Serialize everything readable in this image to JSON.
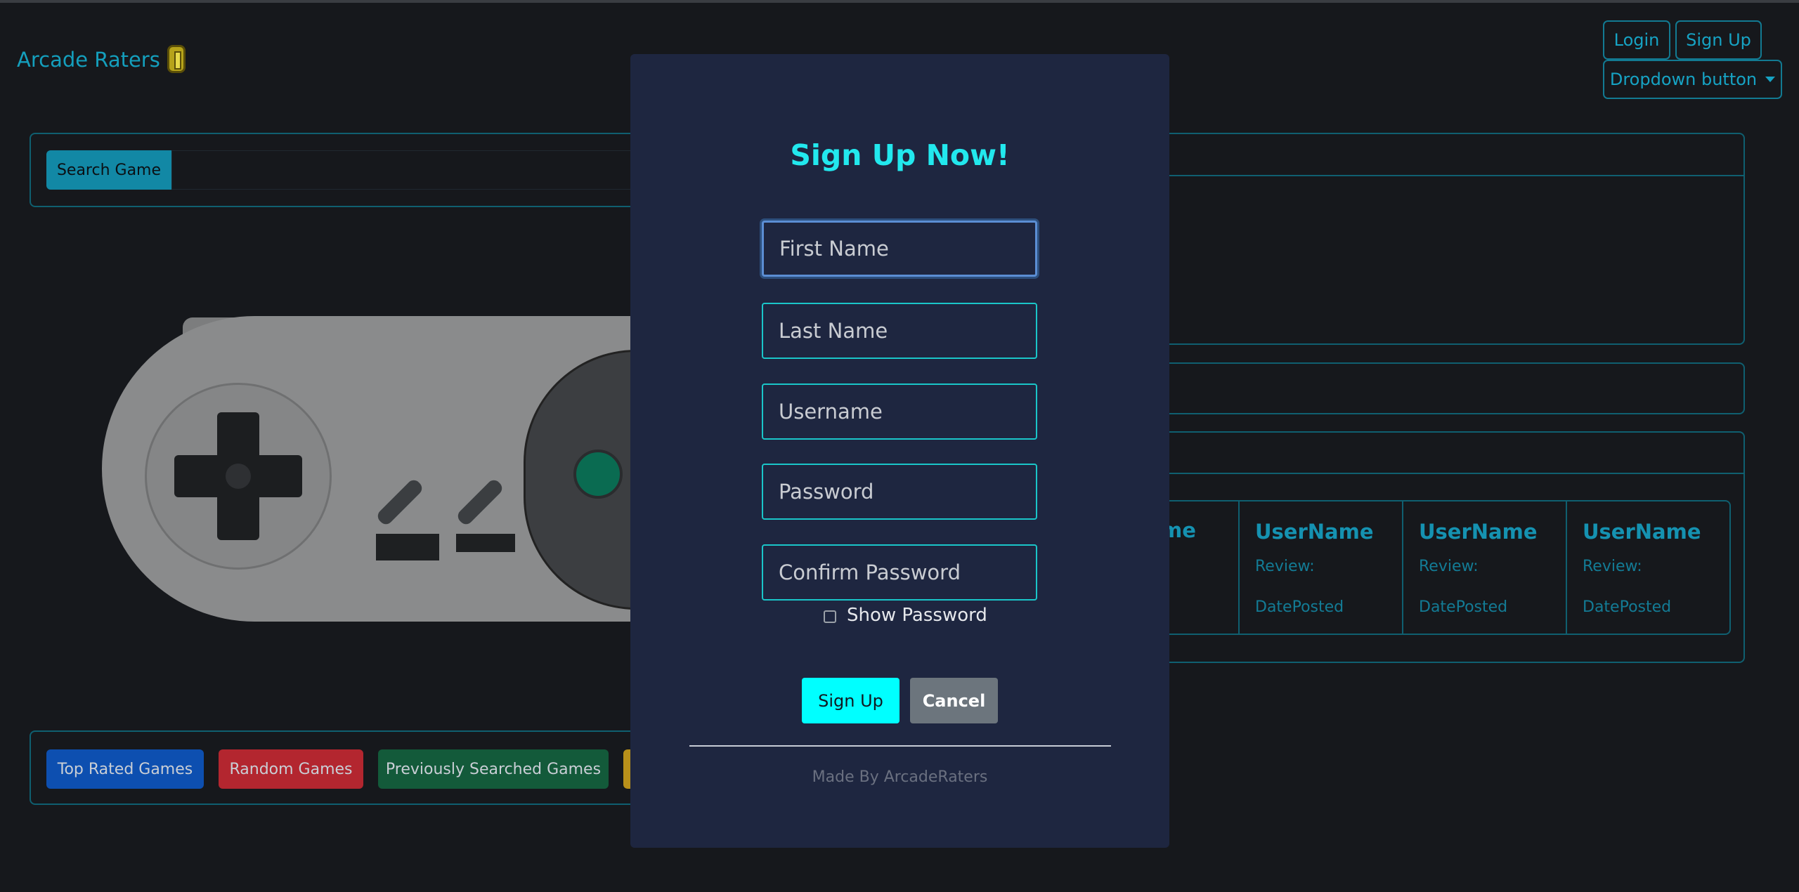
{
  "nav": {
    "brand": "Arcade Raters",
    "login": "Login",
    "signup": "Sign Up",
    "dropdown": "Dropdown button"
  },
  "search": {
    "button_label": "Search Game"
  },
  "reviews": {
    "partial_name": "me",
    "partial_date": "d",
    "items": [
      {
        "name": "UserName",
        "review": "Review:",
        "date": "DatePosted"
      },
      {
        "name": "UserName",
        "review": "Review:",
        "date": "DatePosted"
      },
      {
        "name": "UserName",
        "review": "Review:",
        "date": "DatePosted"
      }
    ]
  },
  "game_buttons": {
    "top_rated": "Top Rated Games",
    "random": "Random Games",
    "previous": "Previously Searched Games"
  },
  "modal": {
    "title": "Sign Up Now!",
    "first_name_placeholder": "First Name",
    "last_name_placeholder": "Last Name",
    "username_placeholder": "Username",
    "password_placeholder": "Password",
    "confirm_password_placeholder": "Confirm Password",
    "show_password_label": "Show Password",
    "signup_button": "Sign Up",
    "cancel_button": "Cancel",
    "footer": "Made By ArcadeRaters"
  },
  "colors": {
    "accent": "#00ffff",
    "modal_bg": "#1e2640",
    "page_bg": "#16181c",
    "top_rated": "#0d4fb0",
    "random": "#b3262f",
    "previous": "#135a3a"
  }
}
